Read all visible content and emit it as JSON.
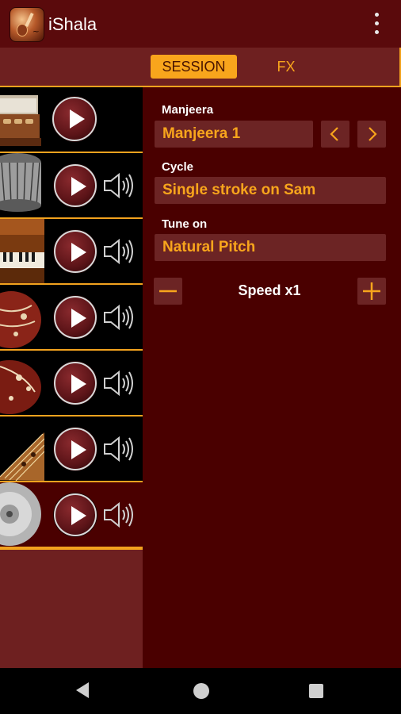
{
  "app": {
    "title": "iShala"
  },
  "tabs": [
    {
      "label": "SESSION",
      "active": true
    },
    {
      "label": "FX",
      "active": false
    }
  ],
  "instruments": [
    {
      "name": "harmonium-top",
      "has_speaker": false
    },
    {
      "name": "tabla",
      "has_speaker": true
    },
    {
      "name": "harmonium",
      "has_speaker": true
    },
    {
      "name": "tanpura",
      "has_speaker": true
    },
    {
      "name": "sitar",
      "has_speaker": true
    },
    {
      "name": "swarmandal",
      "has_speaker": true
    },
    {
      "name": "manjeera",
      "has_speaker": true
    }
  ],
  "settings": {
    "instrument_label": "Manjeera",
    "instrument_value": "Manjeera 1",
    "cycle_label": "Cycle",
    "cycle_value": "Single stroke on Sam",
    "tune_label": "Tune on",
    "tune_value": "Natural Pitch",
    "speed_label": "Speed x1"
  },
  "colors": {
    "accent": "#f8a51c",
    "background": "#4a0000",
    "panel": "#6c2424"
  }
}
